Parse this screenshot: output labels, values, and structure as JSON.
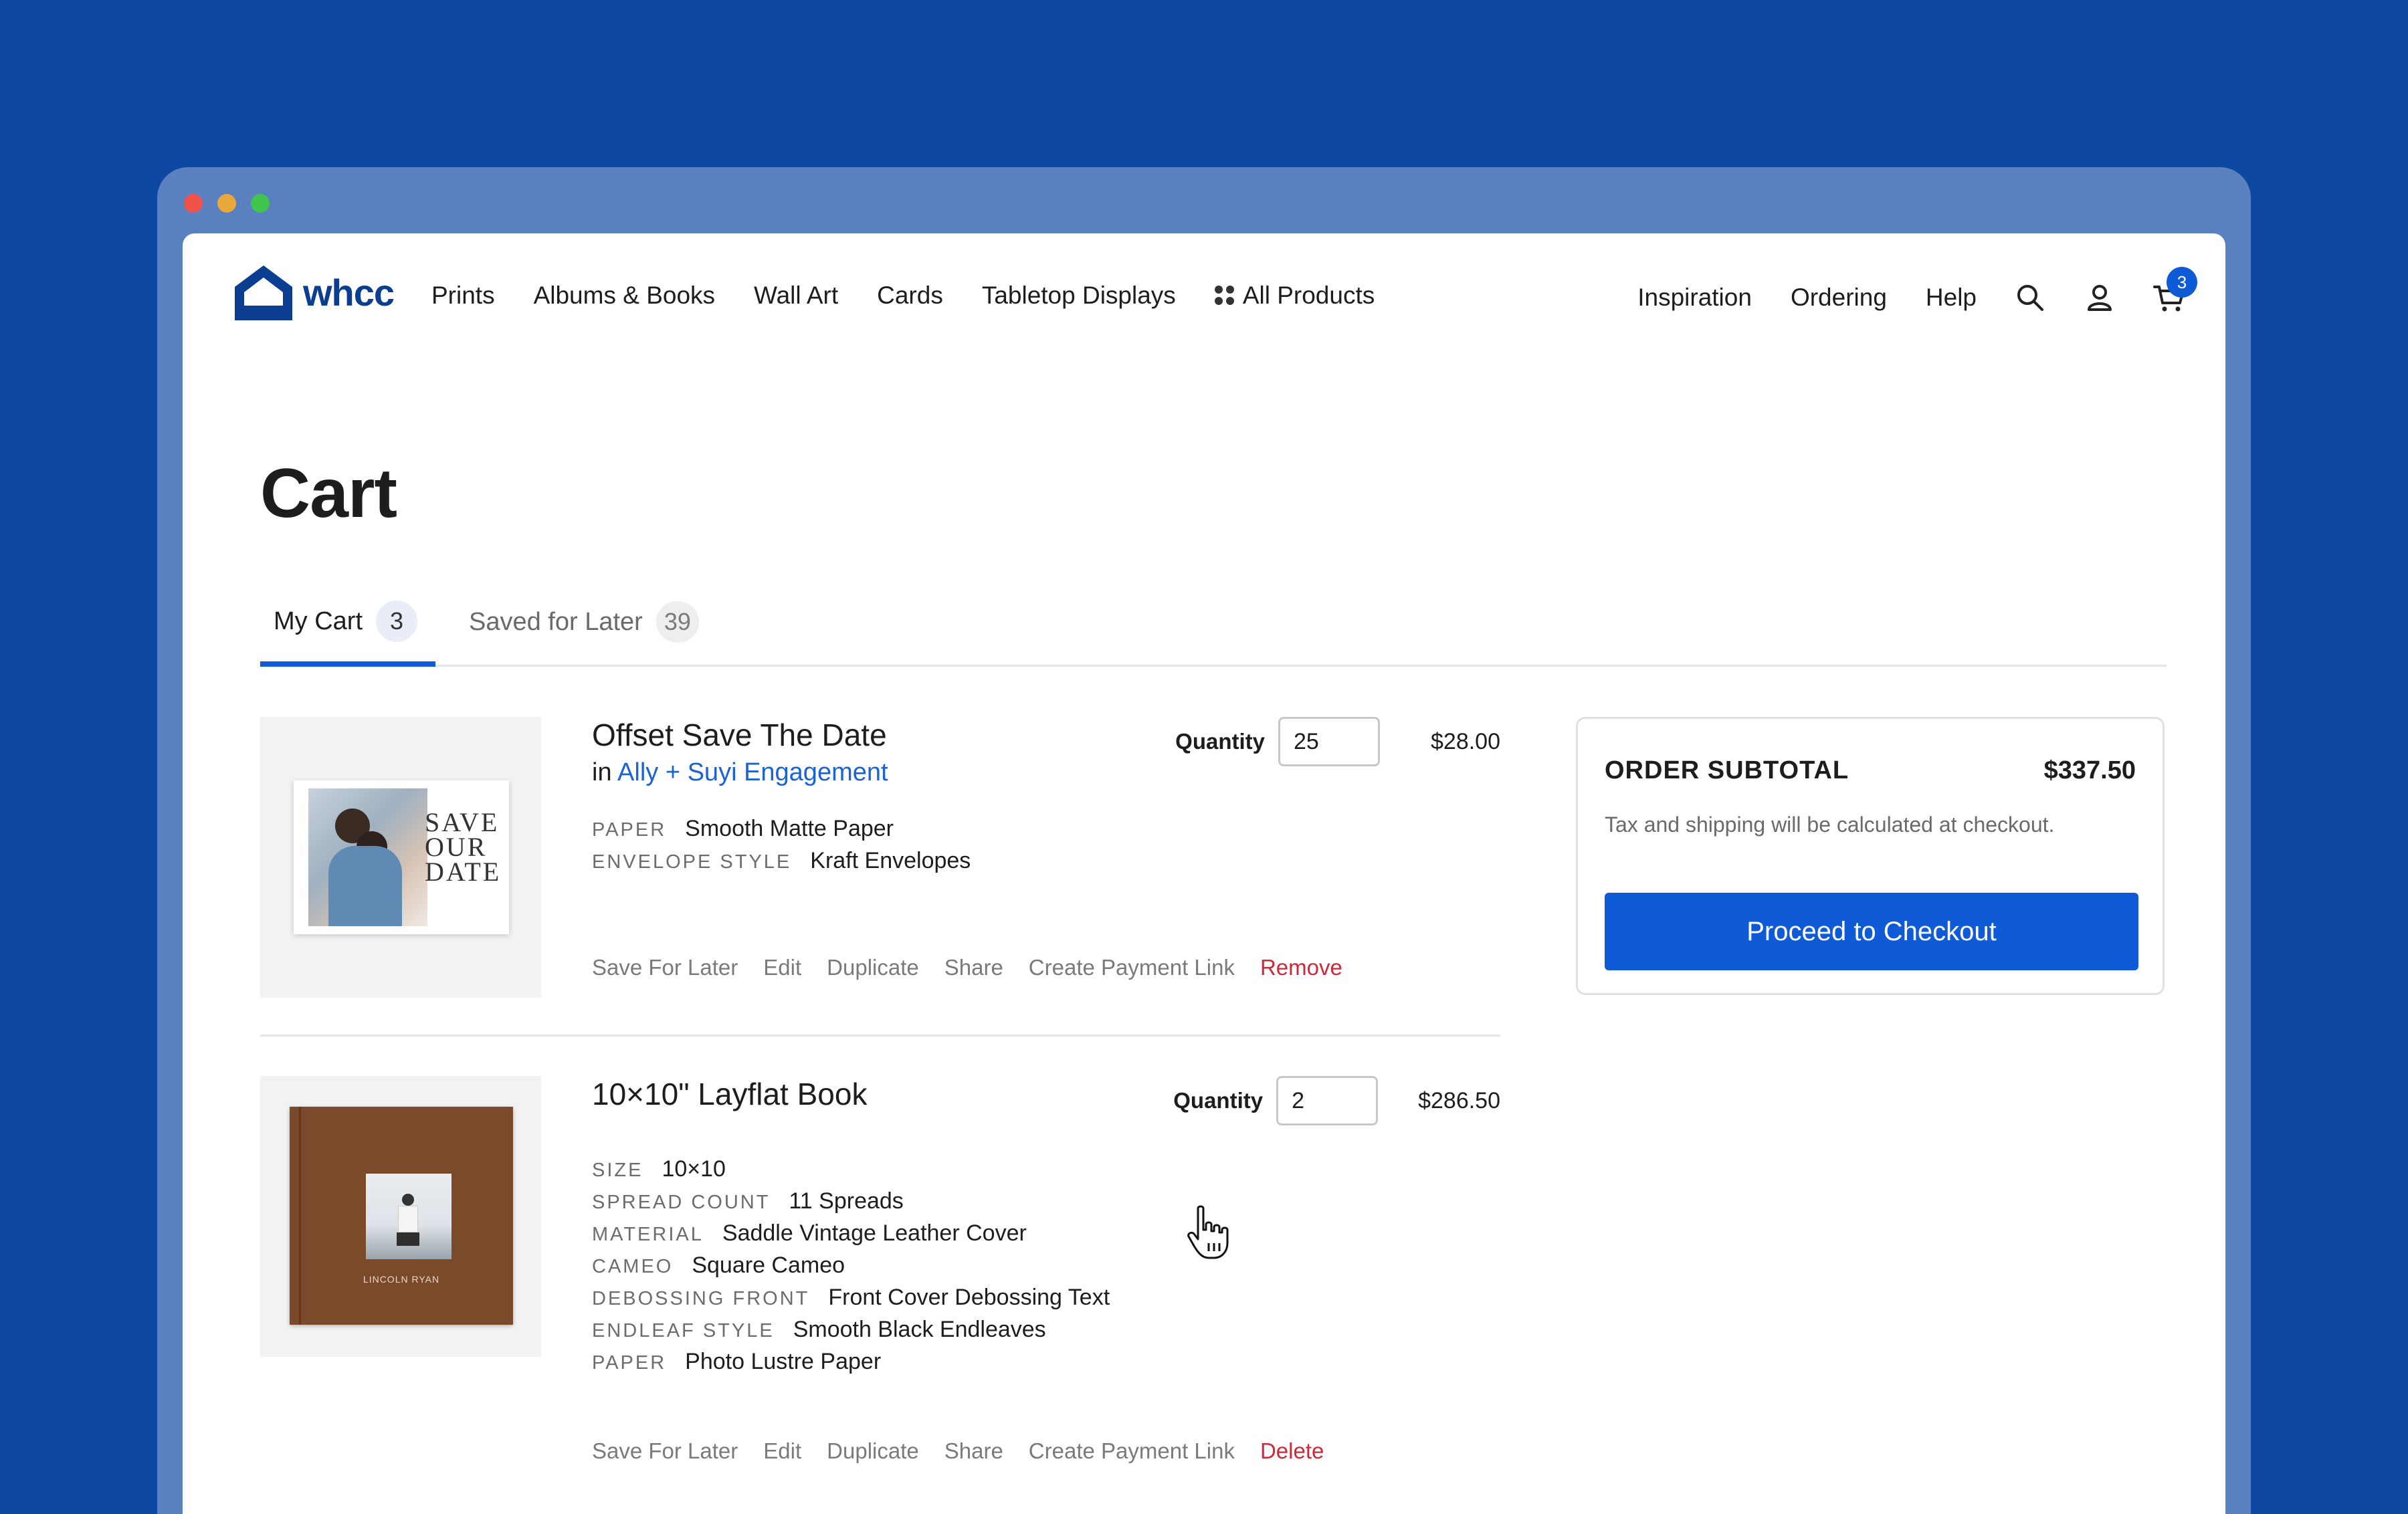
{
  "brand": {
    "name": "whcc",
    "logo_color": "#0b3d91",
    "accent": "#0f5bd7"
  },
  "nav": {
    "left": [
      "Prints",
      "Albums & Books",
      "Wall Art",
      "Cards",
      "Tabletop Displays"
    ],
    "all_products": "All Products",
    "right": [
      "Inspiration",
      "Ordering",
      "Help"
    ],
    "cart_count": "3",
    "icons": [
      "search-icon",
      "user-icon",
      "cart-icon"
    ]
  },
  "page": {
    "title": "Cart"
  },
  "tabs": [
    {
      "label": "My Cart",
      "count": "3",
      "active": true
    },
    {
      "label": "Saved for Later",
      "count": "39",
      "active": false
    }
  ],
  "items": [
    {
      "name": "Offset Save The Date",
      "project_prefix": "in",
      "project": "Ally + Suyi Engagement",
      "quantity": "25",
      "price": "$28.00",
      "thumbnail_text": "SAVE OUR DATE",
      "attributes": [
        {
          "key": "PAPER",
          "value": "Smooth Matte Paper"
        },
        {
          "key": "ENVELOPE STYLE",
          "value": "Kraft Envelopes"
        }
      ],
      "actions": [
        "Save For Later",
        "Edit",
        "Duplicate",
        "Share",
        "Create Payment Link",
        "Remove"
      ]
    },
    {
      "name": "10×10\" Layflat Book",
      "quantity": "2",
      "price": "$286.50",
      "thumbnail_text": "LINCOLN RYAN",
      "attributes": [
        {
          "key": "SIZE",
          "value": "10×10"
        },
        {
          "key": "SPREAD COUNT",
          "value": "11 Spreads"
        },
        {
          "key": "MATERIAL",
          "value": "Saddle Vintage Leather Cover"
        },
        {
          "key": "CAMEO",
          "value": "Square Cameo"
        },
        {
          "key": "DEBOSSING FRONT",
          "value": "Front Cover Debossing Text"
        },
        {
          "key": "ENDLEAF STYLE",
          "value": "Smooth Black Endleaves"
        },
        {
          "key": "PAPER",
          "value": "Photo Lustre Paper"
        }
      ],
      "actions": [
        "Save For Later",
        "Edit",
        "Duplicate",
        "Share",
        "Create Payment Link",
        "Delete"
      ]
    }
  ],
  "quantity_label": "Quantity",
  "summary": {
    "title": "ORDER SUBTOTAL",
    "amount": "$337.50",
    "note": "Tax and shipping will be calculated at checkout.",
    "checkout_label": "Proceed to Checkout"
  }
}
